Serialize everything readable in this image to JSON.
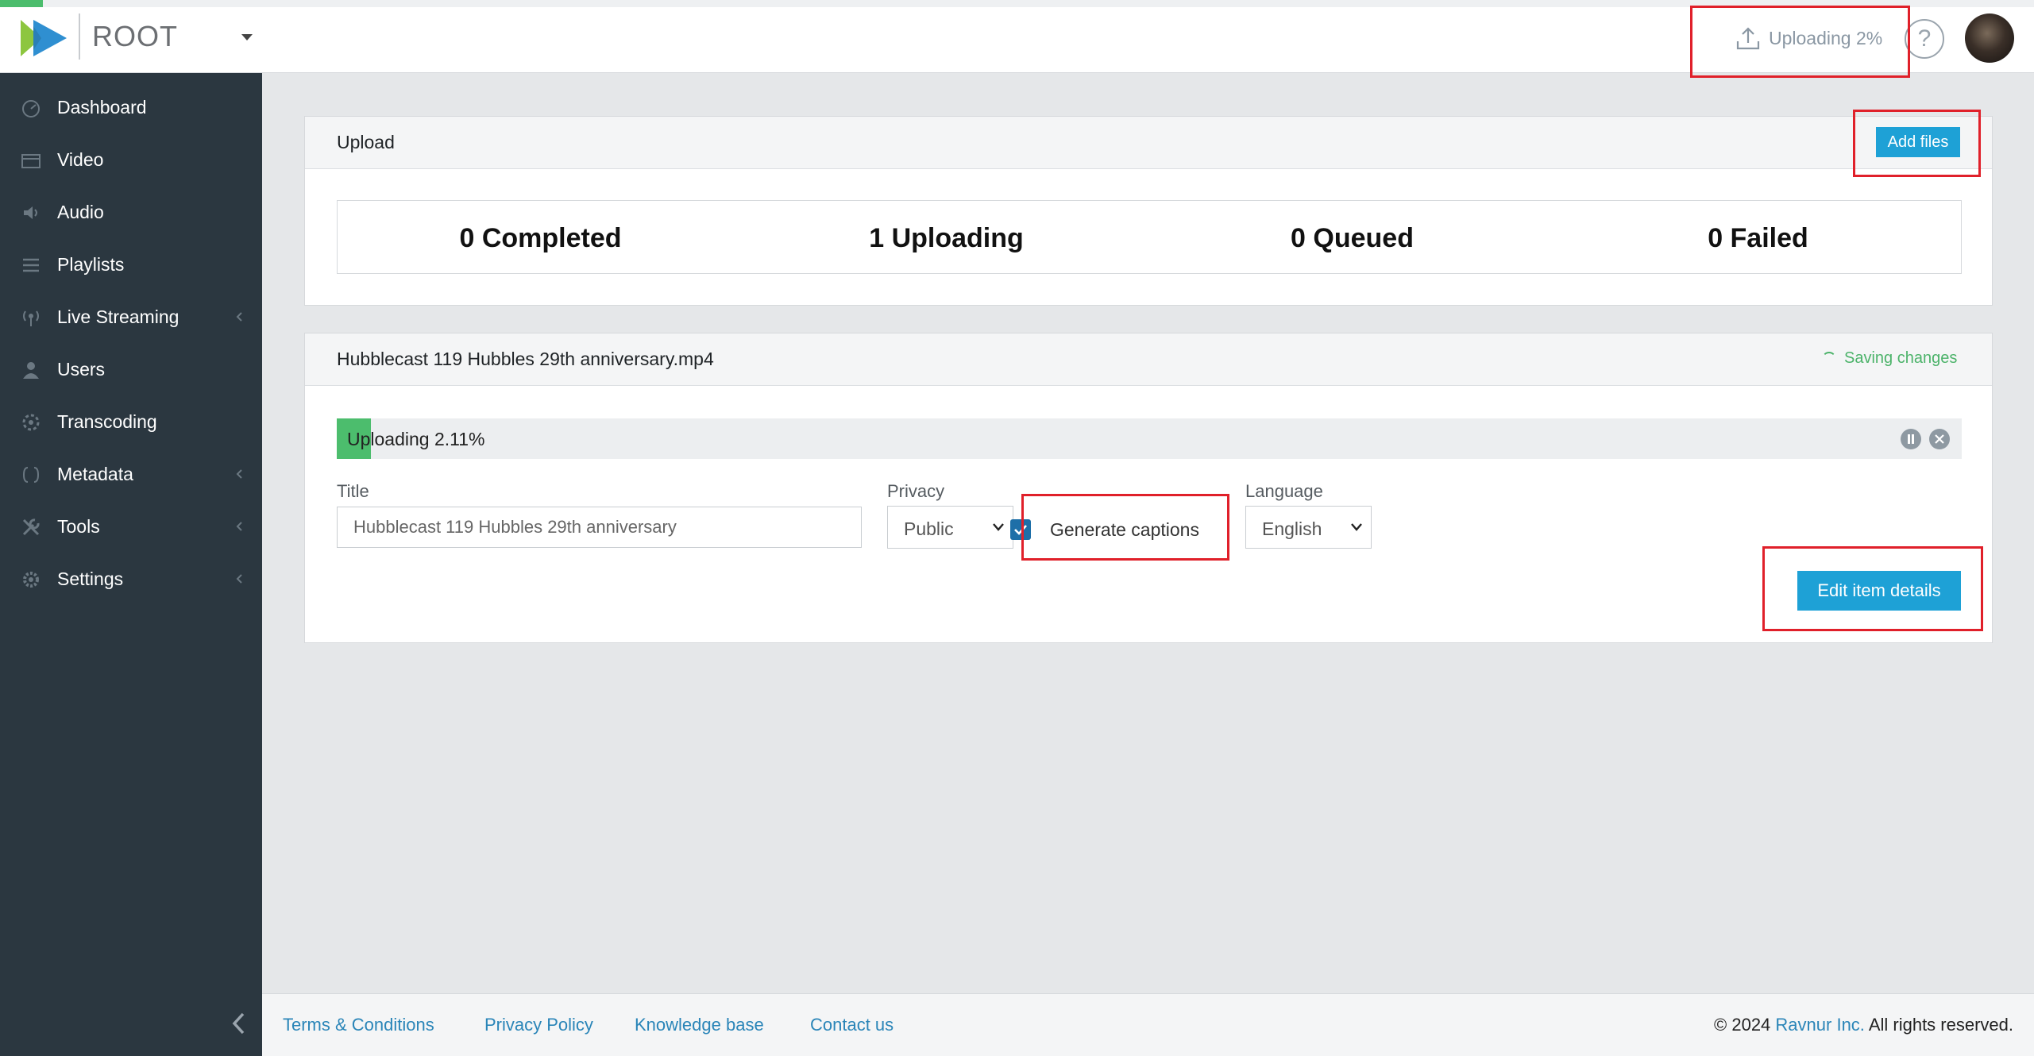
{
  "header": {
    "brand": "ROOT",
    "upload_status": "Uploading 2%",
    "help_glyph": "?"
  },
  "sidebar": {
    "items": [
      {
        "label": "Dashboard",
        "icon": "dashboard-icon"
      },
      {
        "label": "Video",
        "icon": "video-icon"
      },
      {
        "label": "Audio",
        "icon": "audio-icon"
      },
      {
        "label": "Playlists",
        "icon": "playlists-icon"
      },
      {
        "label": "Live Streaming",
        "icon": "live-streaming-icon",
        "expandable": true
      },
      {
        "label": "Users",
        "icon": "users-icon"
      },
      {
        "label": "Transcoding",
        "icon": "transcoding-icon"
      },
      {
        "label": "Metadata",
        "icon": "metadata-icon",
        "expandable": true
      },
      {
        "label": "Tools",
        "icon": "tools-icon",
        "expandable": true
      },
      {
        "label": "Settings",
        "icon": "settings-icon",
        "expandable": true
      }
    ]
  },
  "upload_panel": {
    "title": "Upload",
    "add_files_label": "Add files",
    "stats": {
      "completed": "0 Completed",
      "uploading": "1 Uploading",
      "queued": "0 Queued",
      "failed": "0 Failed"
    }
  },
  "file_panel": {
    "filename": "Hubblecast 119 Hubbles 29th anniversary.mp4",
    "saving_status": "Saving changes",
    "progress_text": "Uploading 2.11%",
    "progress_fraction": 0.0211,
    "title_label": "Title",
    "title_value": "Hubblecast 119 Hubbles 29th anniversary",
    "privacy_label": "Privacy",
    "privacy_value": "Public",
    "generate_captions_label": "Generate captions",
    "generate_captions_checked": true,
    "language_label": "Language",
    "language_value": "English",
    "edit_button_label": "Edit item details"
  },
  "footer": {
    "links": [
      "Terms & Conditions",
      "Privacy Policy",
      "Knowledge base",
      "Contact us"
    ],
    "copyright_prefix": "© 2024 ",
    "company": "Ravnur Inc.",
    "copyright_suffix": " All rights reserved."
  },
  "colors": {
    "accent": "#1ea1d6",
    "sidebar_bg": "#2b3740",
    "progress_green": "#4cbd6d",
    "highlight_red": "#e0202a"
  }
}
